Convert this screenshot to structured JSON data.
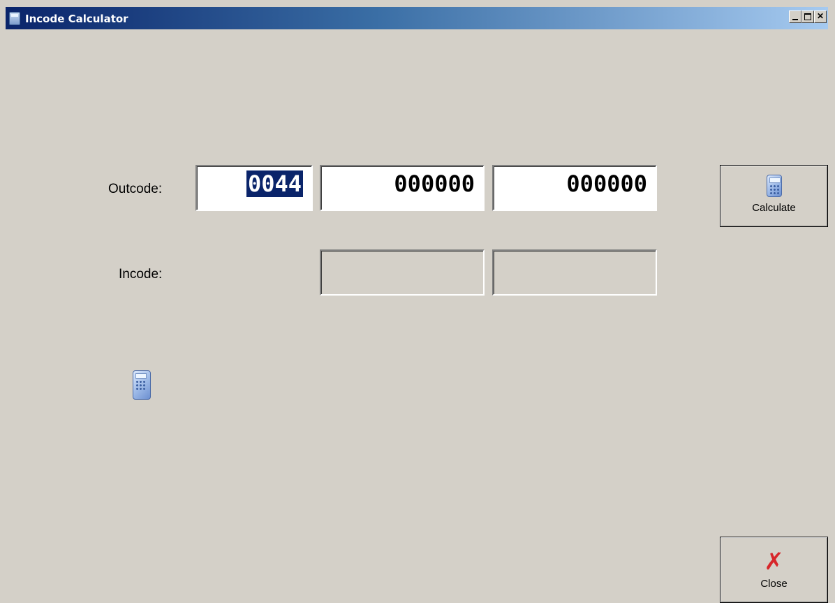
{
  "window": {
    "title": "Incode Calculator",
    "controls": {
      "minimize": "_",
      "maximize": "□",
      "close": "✕"
    }
  },
  "form": {
    "outcode_label": "Outcode:",
    "incode_label": "Incode:",
    "outcode_fields": [
      "0044",
      "000000",
      "000000"
    ],
    "incode_fields": [
      "",
      ""
    ]
  },
  "buttons": {
    "calculate_label": "Calculate",
    "close_label": "Close"
  },
  "icons": {
    "title": "calculator-icon",
    "calculate": "calculator-icon",
    "decorative": "calculator-icon",
    "close": "red-x-icon"
  },
  "colors": {
    "background": "#d4d0c8",
    "title_gradient_start": "#0a246a",
    "title_gradient_end": "#a6caf0",
    "selection": "#0a246a",
    "close_x": "#d7262a"
  }
}
